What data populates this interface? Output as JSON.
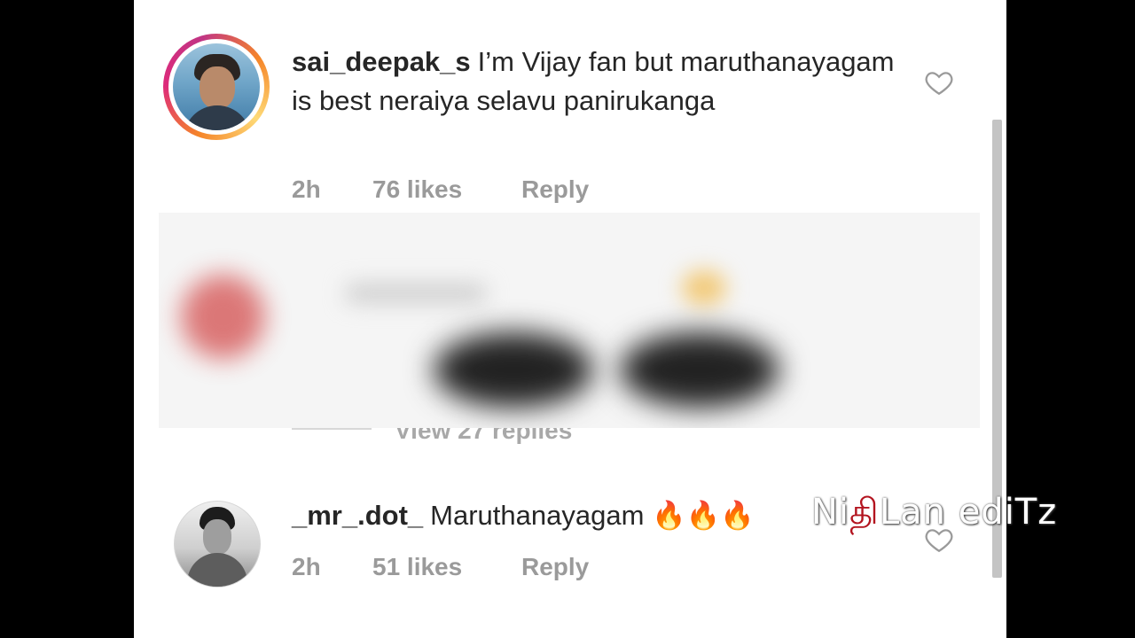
{
  "comments": [
    {
      "username": "sai_deepak_s",
      "text": "I’m Vijay fan but maruthanayagam is best neraiya selavu panirukanga",
      "time": "2h",
      "likes": "76 likes",
      "reply_label": "Reply",
      "avatar_icon": "user-avatar-icon",
      "like_icon": "heart-outline-icon"
    },
    {
      "username": "_mr_.dot_",
      "text": "Maruthanayagam 🔥🔥🔥",
      "time": "2h",
      "likes": "51 likes",
      "reply_label": "Reply",
      "avatar_icon": "user-avatar-icon",
      "like_icon": "heart-outline-icon"
    }
  ],
  "replies_toggle": "View 27 replies",
  "watermark": {
    "prefix": "Ni",
    "accent": "தி",
    "suffix": "Lan ediTz"
  },
  "colors": {
    "background": "#000000",
    "screen": "#ffffff",
    "text": "#262626",
    "muted": "#9a9a9a",
    "watermark_accent": "#b3141f"
  }
}
